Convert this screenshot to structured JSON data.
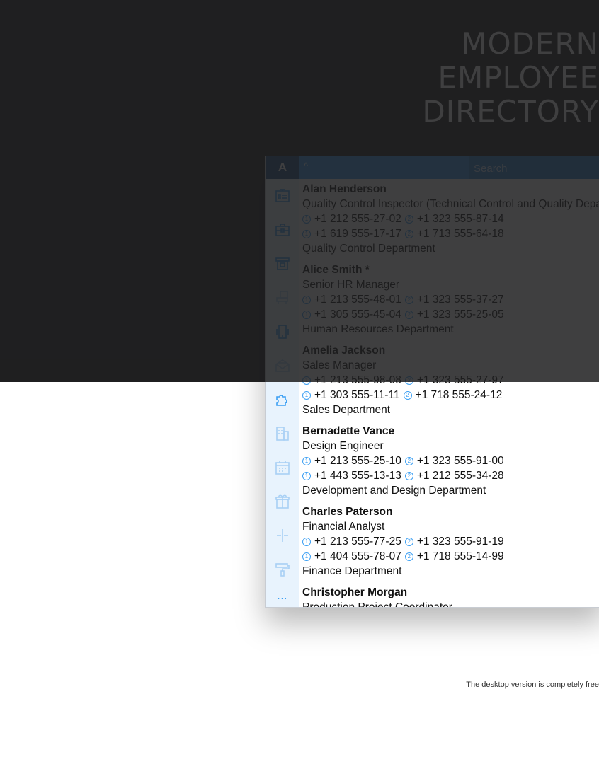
{
  "hero": {
    "title_lines": [
      "MODERN",
      "EMPLOYEE",
      "DIRECTORY"
    ]
  },
  "app": {
    "letter": "A",
    "collapse_label": "^",
    "search": {
      "placeholder": "Search",
      "value": ""
    },
    "rail_icons": [
      "id-card-icon",
      "briefcase-icon",
      "archive-icon",
      "chair-icon",
      "phone-icon",
      "inbox-icon",
      "puzzle-icon",
      "building-icon",
      "calendar-icon",
      "gift-icon",
      "plus-icon",
      "paint-roller-icon"
    ],
    "rail_more": "...",
    "phone_badges": [
      "1",
      "2"
    ],
    "employees": [
      {
        "name": "Alan Henderson",
        "title": "Quality Control Inspector (Technical Control and Quality Department)",
        "phones": [
          [
            "+1 212 555-27-02",
            "+1 323 555-87-14"
          ],
          [
            "+1 619 555-17-17",
            "+1 713 555-64-18"
          ]
        ],
        "department": "Quality Control Department"
      },
      {
        "name": "Alice Smith *",
        "title": "Senior HR Manager",
        "phones": [
          [
            "+1 213 555-48-01",
            "+1 323 555-37-27"
          ],
          [
            "+1 305 555-45-04",
            "+1 323 555-25-05"
          ]
        ],
        "department": "Human Resources Department"
      },
      {
        "name": "Amelia Jackson",
        "title": "Sales Manager",
        "phones": [
          [
            "+1 213 555-98-08",
            "+1 323 555-27-97"
          ],
          [
            "+1 303 555-11-11",
            "+1 718 555-24-12"
          ]
        ],
        "department": "Sales Department"
      },
      {
        "name": "Bernadette Vance",
        "title": "Design Engineer",
        "phones": [
          [
            "+1 213 555-25-10",
            "+1 323 555-91-00"
          ],
          [
            "+1 443 555-13-13",
            "+1 212 555-34-28"
          ]
        ],
        "department": "Development and Design Department"
      },
      {
        "name": "Charles Paterson",
        "title": "Financial Analyst",
        "phones": [
          [
            "+1 213 555-77-25",
            "+1 323 555-91-19"
          ],
          [
            "+1 404 555-78-07",
            "+1 718 555-14-99"
          ]
        ],
        "department": "Finance Department"
      },
      {
        "name": "Christopher Morgan",
        "title": "Production Project Coordinator",
        "phones": [],
        "department": ""
      }
    ]
  },
  "footer": {
    "note": "The desktop version is completely free"
  },
  "colors": {
    "accent": "#3b9ff3",
    "dark": "#1f1f21",
    "letter_bg": "#1f4e8a",
    "rail_bg": "#e8f3fd"
  }
}
